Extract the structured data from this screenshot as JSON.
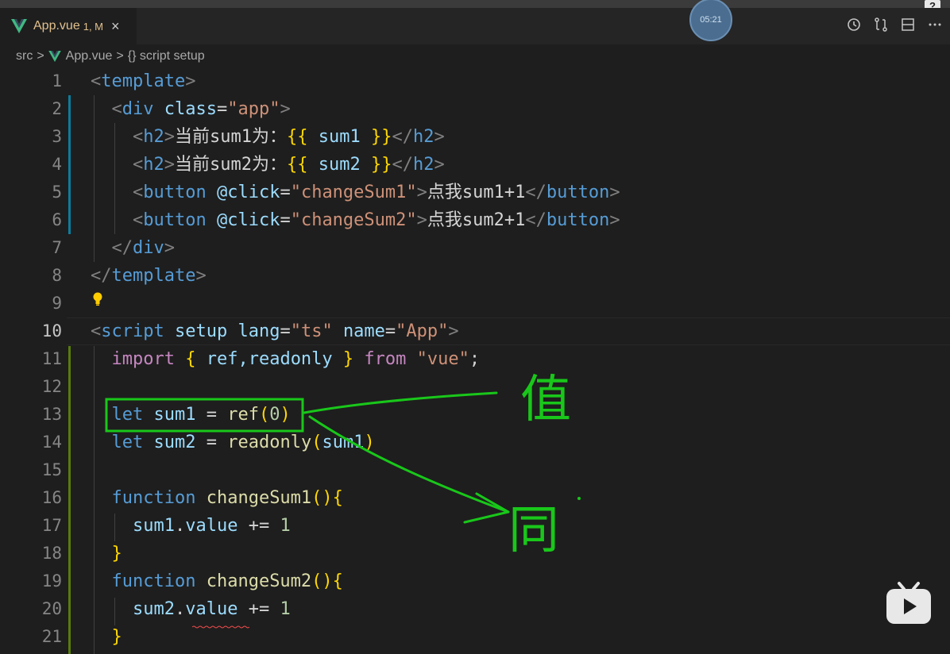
{
  "tab": {
    "file_name": "App.vue",
    "status": "1, M",
    "close": "×"
  },
  "breadcrumb": {
    "part1": "src",
    "part2": "App.vue",
    "part3": "{} script setup",
    "sep": ">"
  },
  "timer": "05:21",
  "help": "?",
  "gutter": [
    "1",
    "2",
    "3",
    "4",
    "5",
    "6",
    "7",
    "8",
    "9",
    "10",
    "11",
    "12",
    "13",
    "14",
    "15",
    "16",
    "17",
    "18",
    "19",
    "20",
    "21"
  ],
  "code": {
    "l1": [
      "<",
      "template",
      ">"
    ],
    "l2": [
      "<",
      "div",
      " ",
      "class",
      "=",
      "\"app\"",
      ">"
    ],
    "l3": [
      "<",
      "h2",
      ">",
      "当前sum1为：",
      "{{",
      " sum1 ",
      "}}",
      "</",
      "h2",
      ">"
    ],
    "l4": [
      "<",
      "h2",
      ">",
      "当前sum2为：",
      "{{",
      " sum2 ",
      "}}",
      "</",
      "h2",
      ">"
    ],
    "l5": [
      "<",
      "button",
      " ",
      "@click",
      "=",
      "\"changeSum1\"",
      ">",
      "点我sum1+1",
      "</",
      "button",
      ">"
    ],
    "l6": [
      "<",
      "button",
      " ",
      "@click",
      "=",
      "\"changeSum2\"",
      ">",
      "点我sum2+1",
      "</",
      "button",
      ">"
    ],
    "l7": [
      "</",
      "div",
      ">"
    ],
    "l8": [
      "</",
      "template",
      ">"
    ],
    "l10": [
      "<",
      "script",
      " ",
      "setup",
      " ",
      "lang",
      "=",
      "\"ts\"",
      " ",
      "name",
      "=",
      "\"App\"",
      ">"
    ],
    "l11": [
      "import",
      " ",
      "{",
      " ref,readonly ",
      "}",
      " ",
      "from",
      " ",
      "\"vue\"",
      ";"
    ],
    "l13": [
      "let",
      " ",
      "sum1",
      " = ",
      "ref",
      "(",
      "0",
      ")"
    ],
    "l14": [
      "let",
      " ",
      "sum2",
      " = ",
      "readonly",
      "(",
      "sum1",
      ")"
    ],
    "l16": [
      "function",
      " ",
      "changeSum1",
      "()",
      "{"
    ],
    "l17": [
      "sum1",
      ".",
      "value",
      " += ",
      "1"
    ],
    "l18": [
      "}"
    ],
    "l19": [
      "function",
      " ",
      "changeSum2",
      "()",
      "{"
    ],
    "l20": [
      "sum2",
      ".",
      "value",
      " += ",
      "1"
    ],
    "l21": [
      "}"
    ]
  },
  "annotation": {
    "char1": "值",
    "char2": "同"
  },
  "colors": {
    "highlight_box": "#19c71a",
    "vue_green": "#41b883",
    "active_line_num": "#c6c6c6"
  }
}
